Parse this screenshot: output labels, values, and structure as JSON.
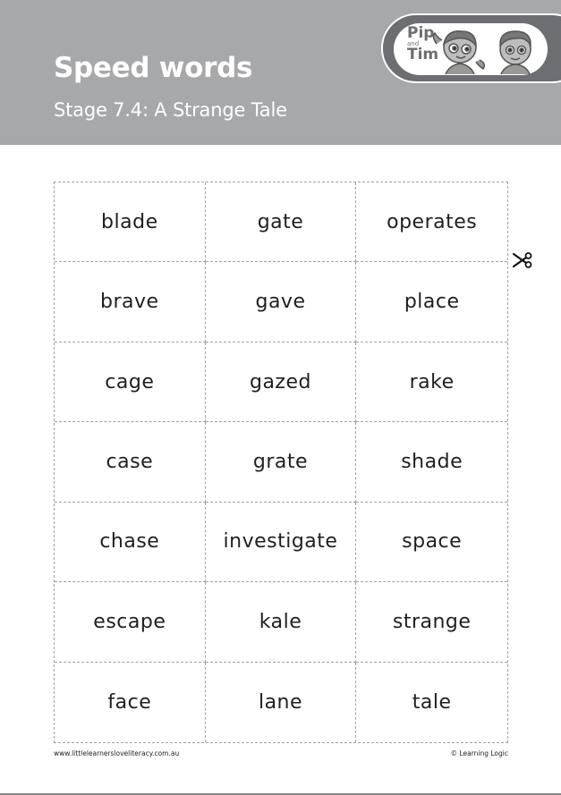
{
  "header": {
    "title": "Speed words",
    "subtitle": "Stage 7.4: A Strange Tale",
    "background_color": "#a7a8aa",
    "logo": {
      "line1": "Pip",
      "line2": "and",
      "line3": "Tim",
      "icon": "pip-and-tim-characters-icon"
    }
  },
  "grid": {
    "rows": [
      [
        "blade",
        "gate",
        "operates"
      ],
      [
        "brave",
        "gave",
        "place"
      ],
      [
        "cage",
        "gazed",
        "rake"
      ],
      [
        "case",
        "grate",
        "shade"
      ],
      [
        "chase",
        "investigate",
        "space"
      ],
      [
        "escape",
        "kale",
        "strange"
      ],
      [
        "face",
        "lane",
        "tale"
      ]
    ],
    "cut_icon": "scissors-icon"
  },
  "footer": {
    "website": "www.littlelearnersloveliteracy.com.au",
    "copyright": "© Learning Logic"
  }
}
